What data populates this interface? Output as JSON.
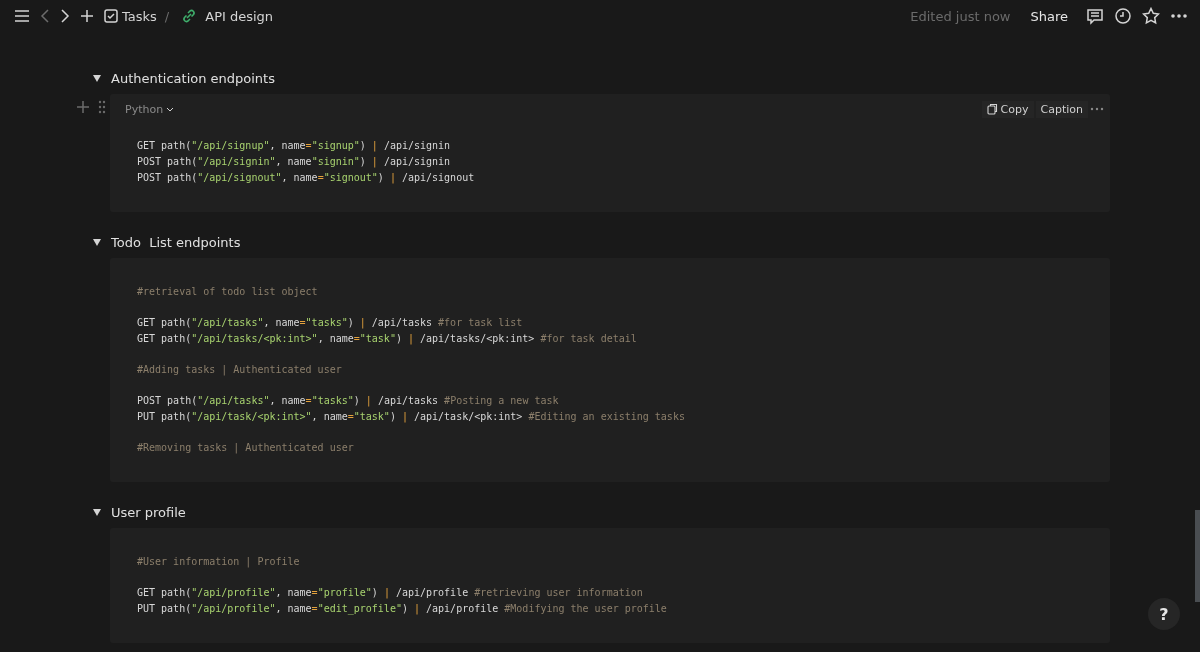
{
  "topbar": {
    "back_disabled": true,
    "breadcrumb": [
      {
        "kind": "page",
        "label": "Tasks"
      },
      {
        "kind": "link",
        "label": "API design"
      }
    ],
    "separator": "/",
    "edited": "Edited just now",
    "share": "Share"
  },
  "sections": [
    {
      "heading": "Authentication endpoints",
      "expanded": true,
      "code": {
        "language": "Python",
        "copy": "Copy",
        "caption": "Caption",
        "groups": [
          [
            [
              {
                "kind": "plain",
                "text": "GET path("
              },
              {
                "kind": "string",
                "text": "\"/api/signup\""
              },
              {
                "kind": "plain",
                "text": ", name"
              },
              {
                "kind": "op",
                "text": "="
              },
              {
                "kind": "string",
                "text": "\"signup\""
              },
              {
                "kind": "plain",
                "text": ") "
              },
              {
                "kind": "op",
                "text": "|"
              },
              {
                "kind": "plain",
                "text": " /api/signin"
              }
            ],
            [
              {
                "kind": "plain",
                "text": "POST path("
              },
              {
                "kind": "string",
                "text": "\"/api/signin\""
              },
              {
                "kind": "plain",
                "text": ", name"
              },
              {
                "kind": "string",
                "text": "\"signin\""
              },
              {
                "kind": "plain",
                "text": ") "
              },
              {
                "kind": "op",
                "text": "|"
              },
              {
                "kind": "plain",
                "text": " /api/signin"
              }
            ],
            [
              {
                "kind": "plain",
                "text": "POST path("
              },
              {
                "kind": "string",
                "text": "\"/api/signout\""
              },
              {
                "kind": "plain",
                "text": ", name"
              },
              {
                "kind": "op",
                "text": "="
              },
              {
                "kind": "string",
                "text": "\"signout\""
              },
              {
                "kind": "plain",
                "text": ") "
              },
              {
                "kind": "op",
                "text": "|"
              },
              {
                "kind": "plain",
                "text": " /api/signout"
              }
            ]
          ]
        ]
      }
    },
    {
      "heading": "Todo  List endpoints",
      "expanded": true,
      "code": {
        "groups": [
          [
            [
              {
                "kind": "comment",
                "text": "#retrieval of todo list object"
              }
            ]
          ],
          [
            [
              {
                "kind": "plain",
                "text": "GET path("
              },
              {
                "kind": "string",
                "text": "\"/api/tasks\""
              },
              {
                "kind": "plain",
                "text": ", name"
              },
              {
                "kind": "op",
                "text": "="
              },
              {
                "kind": "string",
                "text": "\"tasks\""
              },
              {
                "kind": "plain",
                "text": ") "
              },
              {
                "kind": "op",
                "text": "|"
              },
              {
                "kind": "plain",
                "text": " /api/tasks "
              },
              {
                "kind": "comment",
                "text": "#for task list"
              }
            ],
            [
              {
                "kind": "plain",
                "text": "GET path("
              },
              {
                "kind": "string",
                "text": "\"/api/tasks/<pk:int>\""
              },
              {
                "kind": "plain",
                "text": ", name"
              },
              {
                "kind": "op",
                "text": "="
              },
              {
                "kind": "string",
                "text": "\"task\""
              },
              {
                "kind": "plain",
                "text": ") "
              },
              {
                "kind": "op",
                "text": "|"
              },
              {
                "kind": "plain",
                "text": " /api/tasks/<pk:int> "
              },
              {
                "kind": "comment",
                "text": "#for task detail"
              }
            ]
          ],
          [
            [
              {
                "kind": "comment",
                "text": "#Adding tasks | Authenticated user"
              }
            ]
          ],
          [
            [
              {
                "kind": "plain",
                "text": "POST path("
              },
              {
                "kind": "string",
                "text": "\"/api/tasks\""
              },
              {
                "kind": "plain",
                "text": ", name"
              },
              {
                "kind": "op",
                "text": "="
              },
              {
                "kind": "string",
                "text": "\"tasks\""
              },
              {
                "kind": "plain",
                "text": ") "
              },
              {
                "kind": "op",
                "text": "|"
              },
              {
                "kind": "plain",
                "text": " /api/tasks "
              },
              {
                "kind": "comment",
                "text": "#Posting a new task"
              }
            ],
            [
              {
                "kind": "plain",
                "text": "PUT path("
              },
              {
                "kind": "string",
                "text": "\"/api/task/<pk:int>\""
              },
              {
                "kind": "plain",
                "text": ", name"
              },
              {
                "kind": "op",
                "text": "="
              },
              {
                "kind": "string",
                "text": "\"task\""
              },
              {
                "kind": "plain",
                "text": ") "
              },
              {
                "kind": "op",
                "text": "|"
              },
              {
                "kind": "plain",
                "text": " /api/task/<pk:int> "
              },
              {
                "kind": "comment",
                "text": "#Editing an existing tasks"
              }
            ]
          ],
          [
            [
              {
                "kind": "comment",
                "text": "#Removing tasks | Authenticated user"
              }
            ]
          ]
        ]
      }
    },
    {
      "heading": "User profile",
      "expanded": true,
      "code": {
        "groups": [
          [
            [
              {
                "kind": "comment",
                "text": "#User information | Profile"
              }
            ]
          ],
          [
            [
              {
                "kind": "plain",
                "text": "GET path("
              },
              {
                "kind": "string",
                "text": "\"/api/profile\""
              },
              {
                "kind": "plain",
                "text": ", name"
              },
              {
                "kind": "op",
                "text": "="
              },
              {
                "kind": "string",
                "text": "\"profile\""
              },
              {
                "kind": "plain",
                "text": ") "
              },
              {
                "kind": "op",
                "text": "|"
              },
              {
                "kind": "plain",
                "text": " /api/profile "
              },
              {
                "kind": "comment",
                "text": "#retrieving user information"
              }
            ],
            [
              {
                "kind": "plain",
                "text": "PUT path("
              },
              {
                "kind": "string",
                "text": "\"/api/profile\""
              },
              {
                "kind": "plain",
                "text": ", name"
              },
              {
                "kind": "op",
                "text": "="
              },
              {
                "kind": "string",
                "text": "\"edit_profile\""
              },
              {
                "kind": "plain",
                "text": ") "
              },
              {
                "kind": "op",
                "text": "|"
              },
              {
                "kind": "plain",
                "text": " /api/profile "
              },
              {
                "kind": "comment",
                "text": "#Modifying the user profile"
              }
            ]
          ]
        ]
      }
    }
  ],
  "help": "?"
}
